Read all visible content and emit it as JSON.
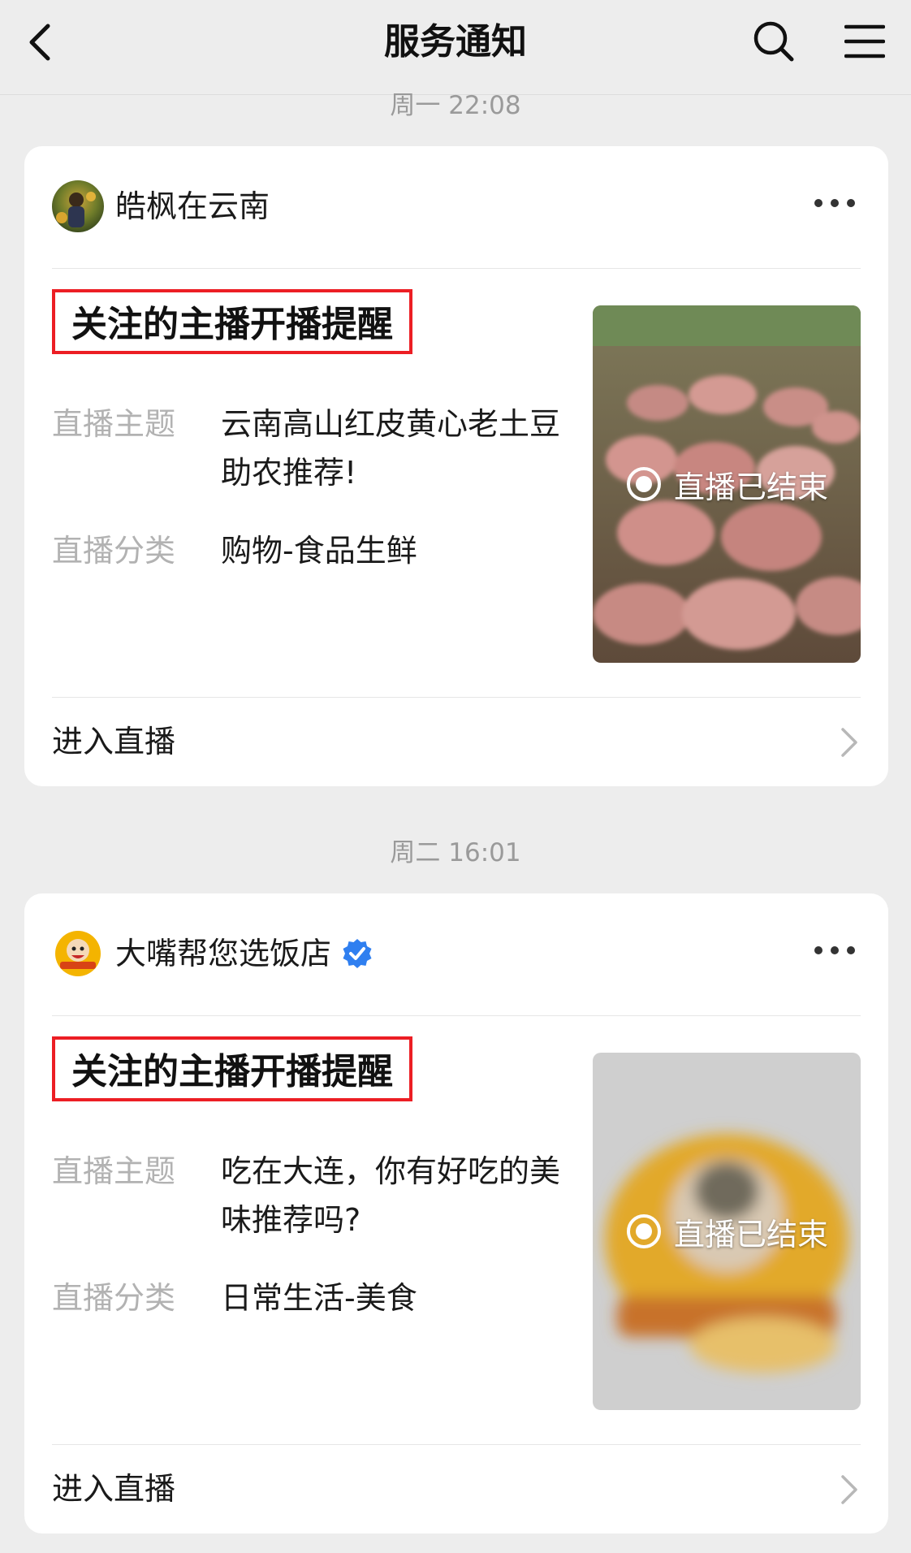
{
  "nav": {
    "title": "服务通知",
    "icons": {
      "back": "chevron-left-icon",
      "search": "search-icon",
      "menu": "menu-icon"
    }
  },
  "messages": [
    {
      "time": "周一 22:08",
      "account": "皓枫在云南",
      "verified": false,
      "notice_title": "关注的主播开播提醒",
      "topic_label": "直播主题",
      "topic_value": "云南高山红皮黄心老土豆助农推荐!",
      "category_label": "直播分类",
      "category_value": "购物-食品生鲜",
      "thumb_status": "直播已结束",
      "enter_label": "进入直播"
    },
    {
      "time": "周二 16:01",
      "account": "大嘴帮您选饭店",
      "verified": true,
      "notice_title": "关注的主播开播提醒",
      "topic_label": "直播主题",
      "topic_value": "吃在大连，你有好吃的美味推荐吗?",
      "category_label": "直播分类",
      "category_value": "日常生活-美食",
      "thumb_status": "直播已结束",
      "enter_label": "进入直播"
    }
  ],
  "colors": {
    "page_bg": "#ededed",
    "card_bg": "#ffffff",
    "highlight_box": "#ec1e24",
    "verified_badge": "#2f7ff0",
    "label_gray": "#b2b2b2"
  }
}
